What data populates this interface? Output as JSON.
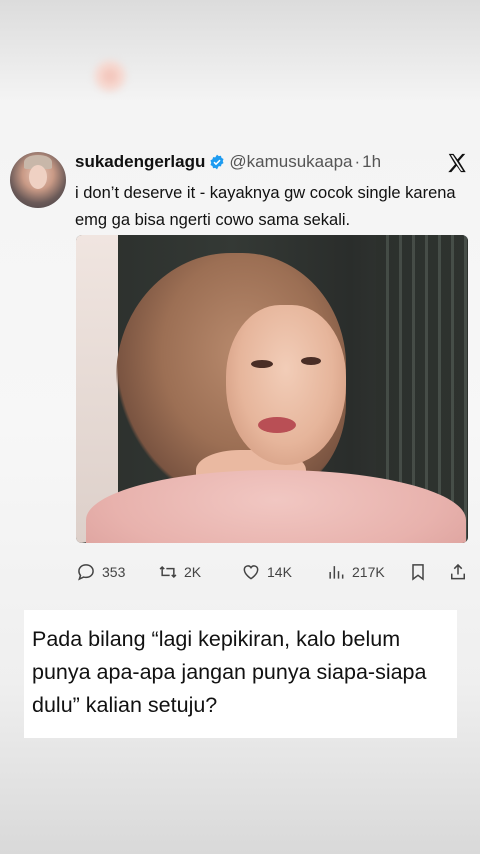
{
  "tweet": {
    "username": "sukadengerlagu",
    "handle": "@kamusukaapa",
    "separator": "·",
    "time": "1h",
    "text": "i don’t deserve it - kayaknya gw cocok single karena emg ga bisa ngerti cowo sama sekali.",
    "stats": {
      "replies": "353",
      "retweets": "2K",
      "likes": "14K",
      "views": "217K"
    }
  },
  "caption": {
    "text": "Pada bilang “lagi kepikiran, kalo belum punya apa-apa jangan punya siapa-siapa dulu” kalian setuju?"
  },
  "colors": {
    "verified": "#1d9bf0",
    "text": "#111111",
    "muted": "#555555"
  }
}
